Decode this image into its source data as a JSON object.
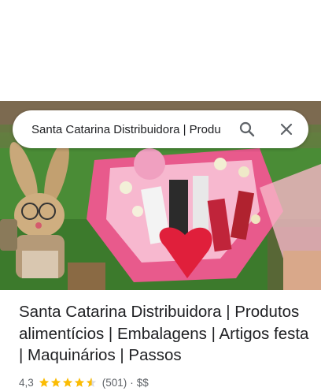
{
  "search": {
    "query": "Santa Catarina Distribuidora | Produ"
  },
  "place": {
    "title": "Santa Catarina Distribuidora | Produtos alimentícios | Embalagens | Artigos festa | Maquinários | Passos",
    "rating": "4,3",
    "rating_numeric": 4.3,
    "reviews": "(501)",
    "separator": "·",
    "price_level": "$$"
  },
  "colors": {
    "star": "#fbbc04",
    "star_empty": "#dadce0",
    "text_primary": "#202124",
    "text_secondary": "#5f6368",
    "icon": "#5f6368"
  },
  "icons": {
    "search": "search-icon",
    "close": "close-icon"
  }
}
